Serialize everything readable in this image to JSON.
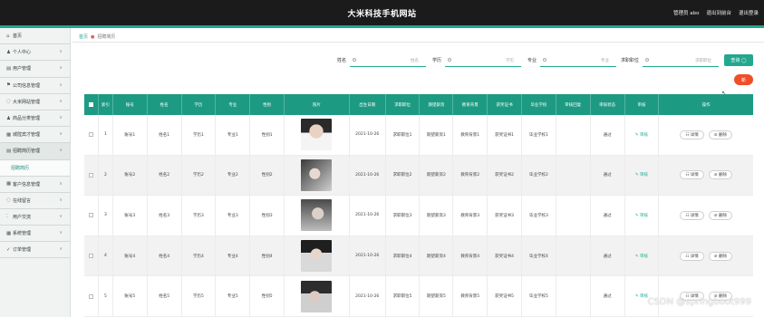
{
  "header": {
    "title": "大米科技手机网站",
    "links": [
      "管理员 abo",
      "退出到前台",
      "退出登录"
    ]
  },
  "sidebar": {
    "items": [
      {
        "label": "首页",
        "icon": "home-icon",
        "glyph": "⌂"
      },
      {
        "label": "个人中心",
        "icon": "person-icon",
        "glyph": "♟"
      },
      {
        "label": "用户管理",
        "icon": "user-manage-icon",
        "glyph": "▤"
      },
      {
        "label": "公司信息管理",
        "icon": "flag-icon",
        "glyph": "⚑"
      },
      {
        "label": "大米网站管理",
        "icon": "globe-icon",
        "glyph": "◌"
      },
      {
        "label": "商品分类管理",
        "icon": "category-icon",
        "glyph": "♟"
      },
      {
        "label": "城隍宾才管理",
        "icon": "grid-icon",
        "glyph": "▦"
      },
      {
        "label": "招聘简历管理",
        "icon": "resume-icon",
        "glyph": "▤"
      },
      {
        "label": "客户信息管理",
        "icon": "customer-icon",
        "glyph": "▦"
      },
      {
        "label": "在线留言",
        "icon": "message-icon",
        "glyph": "◌"
      },
      {
        "label": "用户交流",
        "icon": "chat-icon",
        "glyph": "⁚"
      },
      {
        "label": "系统管理",
        "icon": "system-icon",
        "glyph": "▦"
      },
      {
        "label": "订单管理",
        "icon": "order-icon",
        "glyph": "✓"
      }
    ],
    "sub_item": "招聘简历"
  },
  "breadcrumb": {
    "home": "首页",
    "current": "招聘简历"
  },
  "search": {
    "name_label": "姓名",
    "name_placeholder": "姓名",
    "edu_label": "学历",
    "edu_placeholder": "学历",
    "major_label": "专业",
    "major_placeholder": "专业",
    "school_label": "求职职位",
    "school_placeholder": "求职职位",
    "query_button": "查询 ◯",
    "add_button": "新"
  },
  "table": {
    "headers": [
      "索引",
      "账号",
      "姓名",
      "学历",
      "专业",
      "性别",
      "照片",
      "出生日期",
      "求职职位",
      "期望薪资",
      "教育背景",
      "获奖证书",
      "毕业学校",
      "审核回复",
      "审核状态",
      "审核",
      "操作"
    ],
    "rows": [
      {
        "index": "1",
        "account": "账号1",
        "name": "姓名1",
        "edu": "学历1",
        "major": "专业1",
        "gender": "性别1",
        "birth": "2021-10-26",
        "position": "求职职位1",
        "salary": "期望薪资1",
        "background": "教育背景1",
        "cert": "获奖证书1",
        "school": "毕业学校1",
        "reply": "",
        "status": "通过",
        "audit": "✎ 审核",
        "detail": "☷ 详情",
        "delete": "⊘ 删除"
      },
      {
        "index": "2",
        "account": "账号2",
        "name": "姓名2",
        "edu": "学历2",
        "major": "专业2",
        "gender": "性别2",
        "birth": "2021-10-26",
        "position": "求职职位2",
        "salary": "期望薪资2",
        "background": "教育背景2",
        "cert": "获奖证书2",
        "school": "毕业学校2",
        "reply": "",
        "status": "通过",
        "audit": "✎ 审核",
        "detail": "☷ 详情",
        "delete": "⊘ 删除"
      },
      {
        "index": "3",
        "account": "账号3",
        "name": "姓名3",
        "edu": "学历3",
        "major": "专业3",
        "gender": "性别3",
        "birth": "2021-10-26",
        "position": "求职职位3",
        "salary": "期望薪资3",
        "background": "教育背景3",
        "cert": "获奖证书3",
        "school": "毕业学校3",
        "reply": "",
        "status": "通过",
        "audit": "✎ 审核",
        "detail": "☷ 详情",
        "delete": "⊘ 删除"
      },
      {
        "index": "4",
        "account": "账号4",
        "name": "姓名4",
        "edu": "学历4",
        "major": "专业4",
        "gender": "性别4",
        "birth": "2021-10-26",
        "position": "求职职位4",
        "salary": "期望薪资4",
        "background": "教育背景4",
        "cert": "获奖证书4",
        "school": "毕业学校4",
        "reply": "",
        "status": "通过",
        "audit": "✎ 审核",
        "detail": "☷ 详情",
        "delete": "⊘ 删除"
      },
      {
        "index": "5",
        "account": "账号5",
        "name": "姓名5",
        "edu": "学历5",
        "major": "专业5",
        "gender": "性别5",
        "birth": "2021-10-26",
        "position": "求职职位5",
        "salary": "期望薪资5",
        "background": "教育背景5",
        "cert": "获奖证书5",
        "school": "毕业学校5",
        "reply": "",
        "status": "通过",
        "audit": "✎ 审核",
        "detail": "☷ 详情",
        "delete": "⊘ 删除"
      }
    ]
  },
  "watermark": "CSDN @springboot999",
  "colors": {
    "accent": "#22a88f",
    "header_bg": "#1b1b1b",
    "table_head": "#1c9b82",
    "add_button": "#ef4f27"
  }
}
